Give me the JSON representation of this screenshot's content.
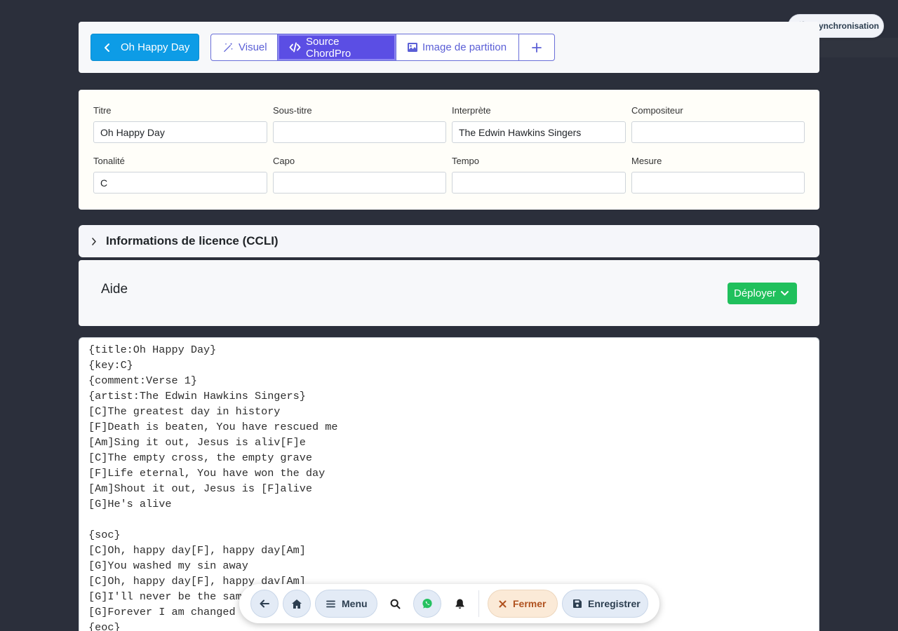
{
  "sync": {
    "label": "Synchronisation"
  },
  "toolbar": {
    "back_label": "Oh Happy Day",
    "tabs": [
      {
        "label": "Visuel"
      },
      {
        "label": "Source ChordPro"
      },
      {
        "label": "Image de partition"
      }
    ],
    "active_tab": "Source ChordPro"
  },
  "meta": {
    "title": {
      "label": "Titre",
      "value": "Oh Happy Day"
    },
    "subtitle": {
      "label": "Sous-titre",
      "value": ""
    },
    "artist": {
      "label": "Interprète",
      "value": "The Edwin Hawkins Singers"
    },
    "composer": {
      "label": "Compositeur",
      "value": ""
    },
    "key": {
      "label": "Tonalité",
      "value": "C"
    },
    "capo": {
      "label": "Capo",
      "value": ""
    },
    "tempo": {
      "label": "Tempo",
      "value": ""
    },
    "time": {
      "label": "Mesure",
      "value": ""
    }
  },
  "license": {
    "title": "Informations de licence (CCLI)"
  },
  "aide": {
    "title": "Aide",
    "deploy_label": "Déployer"
  },
  "editor": {
    "content": "{title:Oh Happy Day}\n{key:C}\n{comment:Verse 1}\n{artist:The Edwin Hawkins Singers}\n[C]The greatest day in history\n[F]Death is beaten, You have rescued me\n[Am]Sing it out, Jesus is aliv[F]e\n[C]The empty cross, the empty grave\n[F]Life eternal, You have won the day\n[Am]Shout it out, Jesus is [F]alive\n[G]He's alive\n\n{soc}\n[C]Oh, happy day[F], happy day[Am]\n[G]You washed my sin away\n[C]Oh, happy day[F], happy day[Am]\n[G]I'll never be the same\n[G]Forever I am changed\n{eoc}"
  },
  "bottom_nav": {
    "menu_label": "Menu",
    "close_label": "Fermer",
    "save_label": "Enregistrer"
  },
  "colors": {
    "background": "#2b2f3b",
    "primary": "#0d9ce6",
    "accent": "#5b4ee4",
    "success": "#20c05c",
    "warning_text": "#b0521f"
  },
  "icons": {
    "sync": "sync-icon",
    "back": "chevron-left-icon",
    "visuel": "magic-wand-icon",
    "source": "code-icon",
    "image": "image-icon",
    "add": "plus-icon",
    "license": "chevron-right-icon",
    "deploy": "chevron-down-icon",
    "nav_back": "arrow-left-icon",
    "home": "home-icon",
    "menu": "bars-icon",
    "search": "search-icon",
    "chat": "whatsapp-icon",
    "bell": "bell-icon",
    "close": "close-icon",
    "save": "save-icon"
  }
}
